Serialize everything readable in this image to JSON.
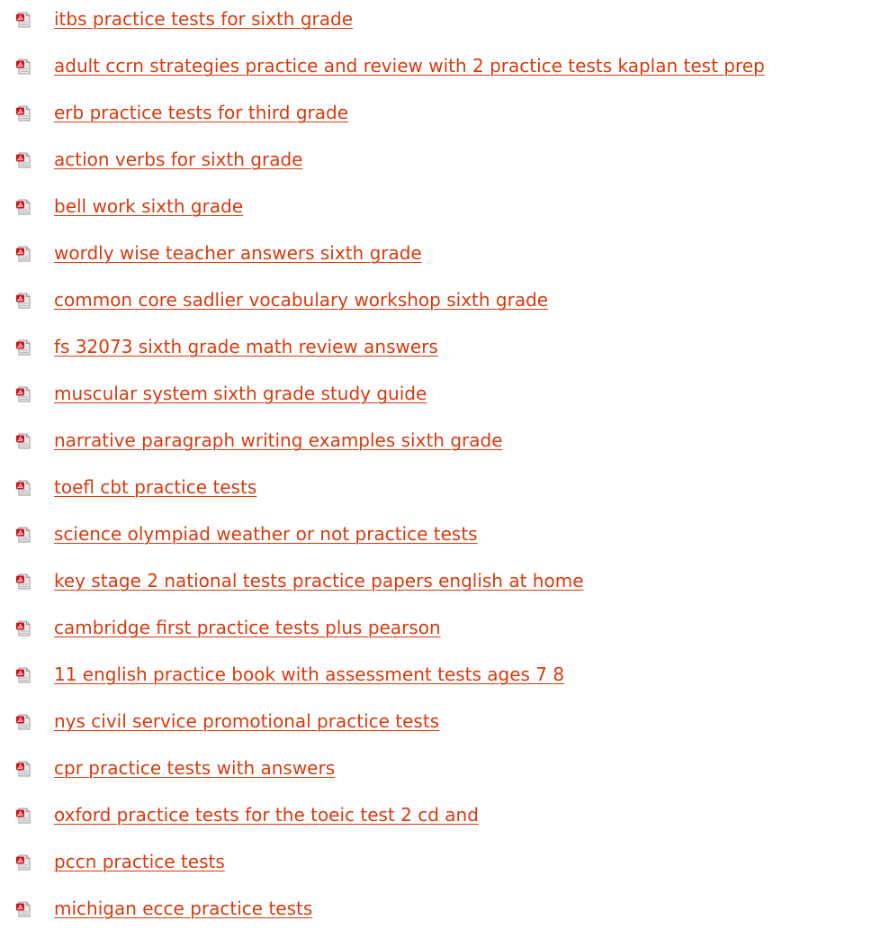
{
  "colors": {
    "link": "#d73a0f",
    "icon_badge": "#d0101a",
    "icon_page": "#e8e8e8"
  },
  "icon": "pdf-file-icon",
  "links": [
    {
      "label": "itbs practice tests for sixth grade"
    },
    {
      "label": "adult ccrn strategies practice and review with 2 practice tests kaplan test prep"
    },
    {
      "label": "erb practice tests for third grade"
    },
    {
      "label": "action verbs for sixth grade"
    },
    {
      "label": "bell work sixth grade"
    },
    {
      "label": "wordly wise teacher answers sixth grade"
    },
    {
      "label": "common core sadlier vocabulary workshop sixth grade"
    },
    {
      "label": "fs 32073 sixth grade math review answers"
    },
    {
      "label": "muscular system sixth grade study guide"
    },
    {
      "label": "narrative paragraph writing examples sixth grade"
    },
    {
      "label": "toefl cbt practice tests"
    },
    {
      "label": "science olympiad weather or not practice tests"
    },
    {
      "label": "key stage 2 national tests practice papers english at home"
    },
    {
      "label": "cambridge first practice tests plus pearson"
    },
    {
      "label": "11 english practice book with assessment tests ages 7 8"
    },
    {
      "label": "nys civil service promotional practice tests"
    },
    {
      "label": "cpr practice tests with answers"
    },
    {
      "label": "oxford practice tests for the toeic test 2 cd and"
    },
    {
      "label": "pccn practice tests"
    },
    {
      "label": "michigan ecce practice tests"
    }
  ]
}
